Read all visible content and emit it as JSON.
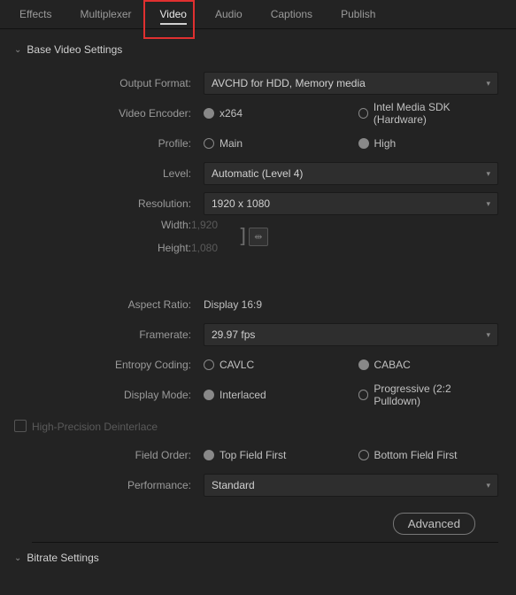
{
  "tabs": {
    "effects": "Effects",
    "multiplexer": "Multiplexer",
    "video": "Video",
    "audio": "Audio",
    "captions": "Captions",
    "publish": "Publish"
  },
  "sections": {
    "base": "Base Video Settings",
    "bitrate": "Bitrate Settings"
  },
  "labels": {
    "output_format": "Output Format:",
    "video_encoder": "Video Encoder:",
    "profile": "Profile:",
    "level": "Level:",
    "resolution": "Resolution:",
    "width": "Width:",
    "height": "Height:",
    "aspect_ratio": "Aspect Ratio:",
    "framerate": "Framerate:",
    "entropy": "Entropy Coding:",
    "display_mode": "Display Mode:",
    "hp_deint": "High-Precision Deinterlace",
    "field_order": "Field Order:",
    "performance": "Performance:"
  },
  "values": {
    "output_format": "AVCHD for HDD, Memory media",
    "encoder_x264": "x264",
    "encoder_intel": "Intel Media SDK (Hardware)",
    "profile_main": "Main",
    "profile_high": "High",
    "level": "Automatic (Level 4)",
    "resolution": "1920 x 1080",
    "width": "1,920",
    "height": "1,080",
    "aspect_ratio": "Display 16:9",
    "framerate": "29.97 fps",
    "cavlc": "CAVLC",
    "cabac": "CABAC",
    "interlaced": "Interlaced",
    "progressive": "Progressive (2:2 Pulldown)",
    "tff": "Top Field First",
    "bff": "Bottom Field First",
    "performance": "Standard",
    "advanced": "Advanced"
  }
}
